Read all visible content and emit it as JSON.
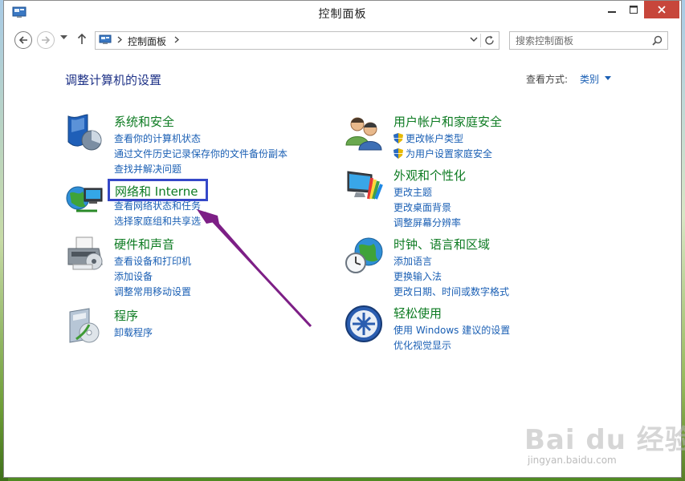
{
  "window": {
    "title": "控制面板"
  },
  "navbar": {
    "breadcrumb": "控制面板",
    "search_placeholder": "搜索控制面板"
  },
  "header": {
    "title": "调整计算机的设置",
    "view_by_label": "查看方式:",
    "view_by_value": "类别"
  },
  "categories": {
    "system": {
      "title": "系统和安全",
      "links": [
        "查看你的计算机状态",
        "通过文件历史记录保存你的文件备份副本",
        "查找并解决问题"
      ]
    },
    "network": {
      "title": "网络和 Interne",
      "links": [
        "查看网络状态和任务",
        "选择家庭组和共享选"
      ]
    },
    "hardware": {
      "title": "硬件和声音",
      "links": [
        "查看设备和打印机",
        "添加设备",
        "调整常用移动设置"
      ]
    },
    "programs": {
      "title": "程序",
      "links": [
        "卸载程序"
      ]
    },
    "users": {
      "title": "用户帐户和家庭安全",
      "links": [
        "更改帐户类型",
        "为用户设置家庭安全"
      ]
    },
    "appearance": {
      "title": "外观和个性化",
      "links": [
        "更改主题",
        "更改桌面背景",
        "调整屏幕分辨率"
      ]
    },
    "clock": {
      "title": "时钟、语言和区域",
      "links": [
        "添加语言",
        "更换输入法",
        "更改日期、时间或数字格式"
      ]
    },
    "ease": {
      "title": "轻松使用",
      "links": [
        "使用 Windows 建议的设置",
        "优化视觉显示"
      ]
    }
  },
  "watermark": {
    "brand": "Bai du 经验",
    "url": "jingyan.baidu.com"
  },
  "colors": {
    "category_title": "#0d7b22",
    "link": "#1a5fb4",
    "page_title": "#1e3287",
    "highlight_border": "#3548c8",
    "arrow": "#7d1f86",
    "close_button": "#c7463b"
  }
}
